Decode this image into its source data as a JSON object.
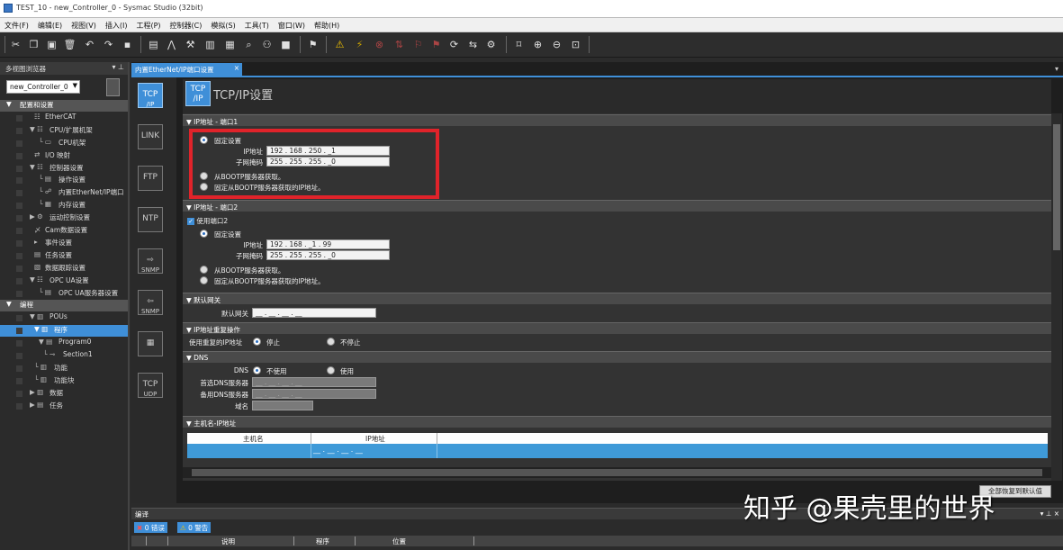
{
  "window": {
    "title": "TEST_10 - new_Controller_0 - Sysmac Studio (32bit)"
  },
  "menu": [
    "文件(F)",
    "编辑(E)",
    "视图(V)",
    "插入(I)",
    "工程(P)",
    "控制器(C)",
    "模拟(S)",
    "工具(T)",
    "窗口(W)",
    "帮助(H)"
  ],
  "left_pane": {
    "title": "多视图浏览器",
    "controller": "new_Controller_0",
    "items": [
      {
        "label": "配置和设置",
        "indent": 0,
        "kind": "section",
        "arrow": "▼"
      },
      {
        "label": "EtherCAT",
        "indent": 2,
        "icon": "☷"
      },
      {
        "label": "CPU/扩展机架",
        "indent": 1,
        "icon": "▼ ☷"
      },
      {
        "label": "CPU机架",
        "indent": 3,
        "icon": "└ ▭"
      },
      {
        "label": "I/O 映射",
        "indent": 2,
        "icon": "⇄"
      },
      {
        "label": "控制器设置",
        "indent": 1,
        "icon": "▼ ☷"
      },
      {
        "label": "操作设置",
        "indent": 3,
        "icon": "└ ▤"
      },
      {
        "label": "内置EtherNet/IP端口",
        "indent": 3,
        "icon": "└ ☍"
      },
      {
        "label": "内存设置",
        "indent": 3,
        "icon": "└ ▦"
      },
      {
        "label": "运动控制设置",
        "indent": 1,
        "icon": "▶ ⚙"
      },
      {
        "label": "Cam数据设置",
        "indent": 2,
        "icon": "〆"
      },
      {
        "label": "事件设置",
        "indent": 2,
        "icon": "▸"
      },
      {
        "label": "任务设置",
        "indent": 2,
        "icon": "▤"
      },
      {
        "label": "数据跟踪设置",
        "indent": 2,
        "icon": "▧"
      },
      {
        "label": "OPC UA设置",
        "indent": 1,
        "icon": "▼ ☷"
      },
      {
        "label": "OPC UA服务器设置",
        "indent": 3,
        "icon": "└ ▤"
      },
      {
        "label": "编程",
        "indent": 0,
        "kind": "section",
        "arrow": "▼"
      },
      {
        "label": "POUs",
        "indent": 1,
        "icon": "▼ ▥"
      },
      {
        "label": "程序",
        "indent": 2,
        "icon": "▼ ▥",
        "kind": "selected"
      },
      {
        "label": "Program0",
        "indent": 3,
        "icon": "▼ ▤"
      },
      {
        "label": "Section1",
        "indent": 4,
        "icon": "└ ⊸"
      },
      {
        "label": "功能",
        "indent": 2,
        "icon": "└ ▥"
      },
      {
        "label": "功能块",
        "indent": 2,
        "icon": "└ ▥"
      },
      {
        "label": "数据",
        "indent": 1,
        "icon": "▶ ▥"
      },
      {
        "label": "任务",
        "indent": 1,
        "icon": "▶ ▤"
      }
    ]
  },
  "doc_tab": {
    "label": "内置EtherNet/IP端口设置",
    "close": "×"
  },
  "side_icons": [
    {
      "line1": "TCP",
      "line2": "/IP",
      "active": true
    },
    {
      "line1": "LINK",
      "line2": ""
    },
    {
      "line1": "FTP",
      "line2": ""
    },
    {
      "line1": "NTP",
      "line2": ""
    },
    {
      "line1": "⇨",
      "line2": "SNMP"
    },
    {
      "line1": "⇦",
      "line2": "SNMP"
    },
    {
      "line1": "▦",
      "line2": ""
    },
    {
      "line1": "TCP",
      "line2": "UDP"
    }
  ],
  "panel": {
    "icon_l1": "TCP",
    "icon_l2": "/IP",
    "title": "TCP/IP设置"
  },
  "port1": {
    "header": "▼ IP地址 - 端口1",
    "fixed": "固定设置",
    "ip_label": "IP地址",
    "ip": "192 . 168 . 250 . _1",
    "mask_label": "子网掩码",
    "mask": "255 . 255 . 255 . _0",
    "bootp": "从BOOTP服务器获取。",
    "bootp_fixed": "固定从BOOTP服务器获取的IP地址。"
  },
  "port2": {
    "header": "▼ IP地址 - 端口2",
    "use_port": "使用端口2",
    "fixed": "固定设置",
    "ip_label": "IP地址",
    "ip": "192 . 168 . _1 . 99",
    "mask_label": "子网掩码",
    "mask": "255 . 255 . 255 . _0",
    "bootp": "从BOOTP服务器获取。",
    "bootp_fixed": "固定从BOOTP服务器获取的IP地址。"
  },
  "gateway": {
    "header": "▼ 默认网关",
    "label": "默认网关",
    "value": "__ . __ . __ . __"
  },
  "dup": {
    "header": "▼ IP地址重复操作",
    "label": "使用重复的IP地址",
    "opt1": "停止",
    "opt2": "不停止"
  },
  "dns": {
    "header": "▼ DNS",
    "label": "DNS",
    "opt1": "不使用",
    "opt2": "使用",
    "primary_label": "首选DNS服务器",
    "primary": "__ . __ . __ . __",
    "secondary_label": "备用DNS服务器",
    "secondary": "__ . __ . __ . __",
    "domain_label": "域名"
  },
  "hosts": {
    "header": "▼ 主机名-IP地址",
    "col_host": "主机名",
    "col_ip": "IP地址",
    "row_ip": "__ . __ . __ . __"
  },
  "restore_button": "全部恢复到默认值",
  "build": {
    "title": "编译",
    "errors": "0 错误",
    "warnings": "0 警告",
    "col_desc": "说明",
    "col_prog": "程序",
    "col_pos": "位置"
  },
  "watermark": "知乎 @果壳里的世界"
}
